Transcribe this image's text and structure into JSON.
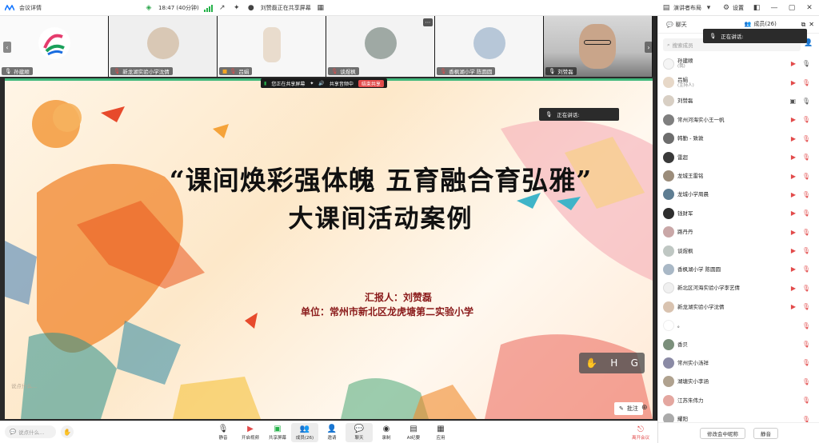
{
  "topbar": {
    "meeting_info": "会议详情",
    "time": "18:47 (40分钟)",
    "sharing_notice": "刘赞磊正在共享屏幕",
    "layout": "演讲者布局",
    "settings": "设置"
  },
  "strip": {
    "tiles": [
      {
        "name": "孙建顺"
      },
      {
        "name": "新龙湖实验小学沈倩"
      },
      {
        "name": "吕娟"
      },
      {
        "name": "谈煜枫"
      },
      {
        "name": "香枫湖小学 陈圆圆"
      },
      {
        "name": "刘赞磊"
      }
    ]
  },
  "sharebar": {
    "sharing": "您正在共享屏幕",
    "audio": "共享音频中",
    "stop": "结束共享"
  },
  "speaking": {
    "label": "正在讲话:"
  },
  "slide": {
    "title": "“课间焕彩强体魄  五育融合育弘雅”",
    "subtitle": "大课间活动案例",
    "reporter": "汇报人：刘赞磊",
    "unit": "单位：常州市新北区龙虎塘第二实验小学",
    "watermark": "说点什么..."
  },
  "hg": {
    "h": "H",
    "g": "G"
  },
  "annotate": "批注",
  "toolbar": {
    "chat_placeholder": "说点什么...",
    "items": [
      {
        "label": "静音",
        "icon": "mic-icon"
      },
      {
        "label": "开启视频",
        "icon": "video-icon"
      },
      {
        "label": "共享屏幕",
        "icon": "share-screen-icon"
      },
      {
        "label": "成员(26)",
        "icon": "members-icon"
      },
      {
        "label": "邀请",
        "icon": "invite-icon"
      },
      {
        "label": "聊天",
        "icon": "chat-icon"
      },
      {
        "label": "录制",
        "icon": "record-icon"
      },
      {
        "label": "AI纪要",
        "icon": "ai-notes-icon"
      },
      {
        "label": "应用",
        "icon": "apps-icon"
      }
    ],
    "leave": "离开会议"
  },
  "panel": {
    "tab_chat": "聊天",
    "tab_members": "成员(26)",
    "search_placeholder": "搜索成员",
    "members": [
      {
        "name": "孙建顺",
        "role": "(我)"
      },
      {
        "name": "吕娟",
        "role": "(主持人)"
      },
      {
        "name": "刘赞磊",
        "role": ""
      },
      {
        "name": "常州河海实小王一帆",
        "role": ""
      },
      {
        "name": "韩勤 - 致敦",
        "role": ""
      },
      {
        "name": "雷超",
        "role": ""
      },
      {
        "name": "龙城王雷铭",
        "role": ""
      },
      {
        "name": "龙城小学周晨",
        "role": ""
      },
      {
        "name": "钱财军",
        "role": ""
      },
      {
        "name": "路丹丹",
        "role": ""
      },
      {
        "name": "谈煜枫",
        "role": ""
      },
      {
        "name": "香枫湖小学 陈圆圆",
        "role": ""
      },
      {
        "name": "新北区河海实验小学李艺倩",
        "role": ""
      },
      {
        "name": "新龙湖实验小学沈倩",
        "role": ""
      },
      {
        "name": "。",
        "role": ""
      },
      {
        "name": "香贝",
        "role": ""
      },
      {
        "name": "常州实小汤祥",
        "role": ""
      },
      {
        "name": "湖塘实小李涵",
        "role": ""
      },
      {
        "name": "江苏朱伟力",
        "role": ""
      },
      {
        "name": "耀阳",
        "role": ""
      }
    ],
    "btn_rename": "修改会中昵称",
    "btn_mute": "静音"
  }
}
